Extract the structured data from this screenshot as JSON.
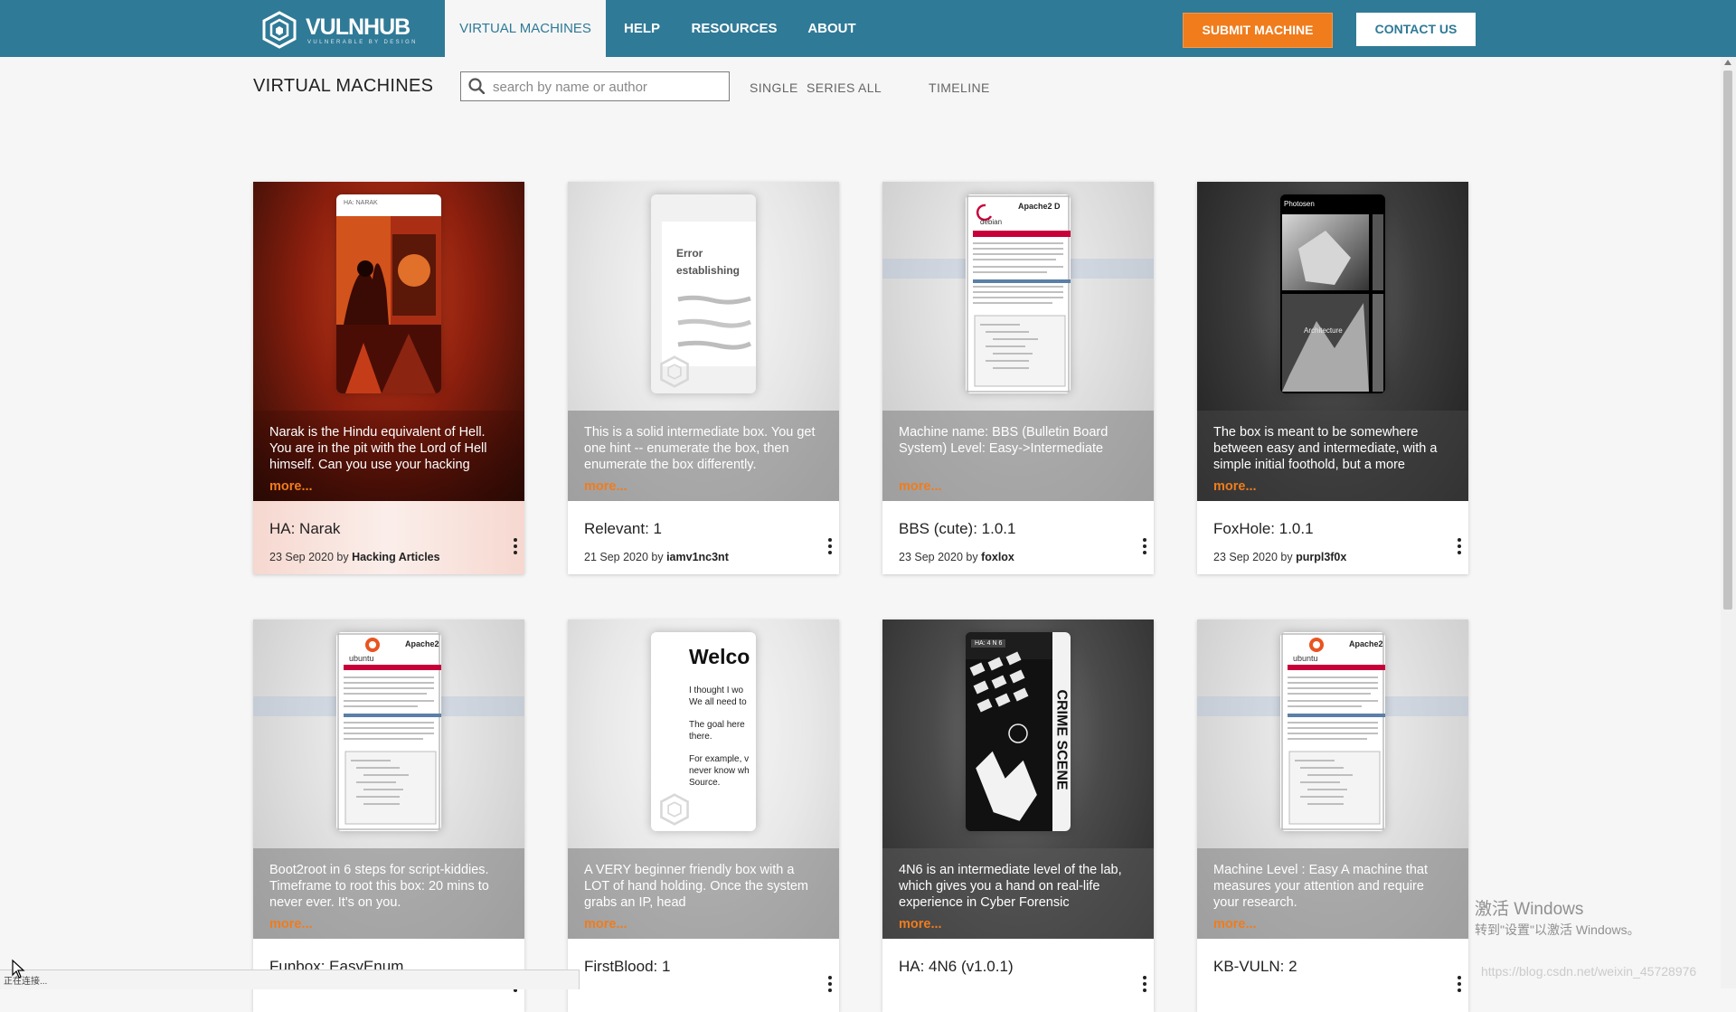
{
  "nav": {
    "brand": "VULNHUB",
    "tagline": "VULNERABLE BY DESIGN",
    "items": [
      {
        "label": "VIRTUAL MACHINES",
        "active": true
      },
      {
        "label": "HELP",
        "active": false
      },
      {
        "label": "RESOURCES",
        "active": false
      },
      {
        "label": "ABOUT",
        "active": false
      }
    ],
    "submit_label": "SUBMIT MACHINE",
    "contact_label": "CONTACT US"
  },
  "toolbar": {
    "title": "VIRTUAL MACHINES",
    "search_placeholder": "search by name or author",
    "search_value": "",
    "filters": [
      "SINGLE",
      "SERIES",
      "ALL",
      "TIMELINE"
    ]
  },
  "more_label": "more...",
  "machines": [
    {
      "title": "HA: Narak",
      "date": "23 Sep 2020",
      "by": "by",
      "author": "Hacking Articles",
      "description": "Narak is the Hindu equivalent of Hell. You are in the pit with the Lord of Hell himself. Can you use your hacking",
      "thumbnail": "ha-narak-artwork",
      "thumb_caption": "HA: NARAK"
    },
    {
      "title": "Relevant: 1",
      "date": "21 Sep 2020",
      "by": "by",
      "author": "iamv1nc3nt",
      "description": "This is a solid intermediate box. You get one hint -- enumerate the box, then enumerate the box differently.",
      "thumbnail": "error-page",
      "thumb_caption": "Error establishing your webz!"
    },
    {
      "title": "BBS (cute): 1.0.1",
      "date": "23 Sep 2020",
      "by": "by",
      "author": "foxlox",
      "description": "Machine name: BBS (Bulletin Board System) Level: Easy->Intermediate",
      "thumbnail": "debian-apache-default",
      "thumb_caption": "Apache2 D",
      "thumb_logo": "debian"
    },
    {
      "title": "FoxHole: 1.0.1",
      "date": "23 Sep 2020",
      "by": "by",
      "author": "purpl3f0x",
      "description": "The box is meant to be somewhere between easy and intermediate, with a simple initial foothold, but a more",
      "thumbnail": "photosen-gallery",
      "thumb_caption": "Photosen",
      "thumb_caption2": "Architecture"
    },
    {
      "title": "Funbox: EasyEnum",
      "date": "",
      "by": "",
      "author": "",
      "description": "Boot2root in 6 steps for script-kiddies. Timeframe to root this box: 20 mins to never ever. It's on you.",
      "thumbnail": "ubuntu-apache-default",
      "thumb_caption": "Apache2",
      "thumb_logo": "ubuntu"
    },
    {
      "title": "FirstBlood: 1",
      "date": "",
      "by": "",
      "author": "",
      "description": "A VERY beginner friendly box with a LOT of hand holding. Once the system grabs an IP, head",
      "thumbnail": "welcome-page",
      "thumb_caption": "Welco",
      "thumb_lines": [
        "I thought I wo",
        "We all need to",
        "The goal here",
        "there.",
        "For example, v",
        "never know wh",
        "Source."
      ]
    },
    {
      "title": "HA: 4N6 (v1.0.1)",
      "date": "",
      "by": "",
      "author": "",
      "description": "4N6 is an intermediate level of the lab, which gives you a hand on real-life experience in Cyber Forensic",
      "thumbnail": "crime-scene",
      "thumb_caption": "HA: 4 N 6",
      "thumb_caption2": "CRIME SCENE"
    },
    {
      "title": "KB-VULN: 2",
      "date": "",
      "by": "",
      "author": "",
      "description": "Machine Level : Easy A machine that measures your attention and require your research.",
      "thumbnail": "ubuntu-apache-default",
      "thumb_caption": "Apache2",
      "thumb_logo": "ubuntu"
    }
  ],
  "overlay": {
    "windows_watermark": "激活 Windows",
    "windows_watermark_sub": "转到\"设置\"以激活 Windows。",
    "csdn_watermark": "https://blog.csdn.net/weixin_45728976",
    "status_text": "正在连接..."
  },
  "colors": {
    "brand": "#2f7a97",
    "accent": "#f07c1c",
    "page_bg": "#f6f6f6"
  }
}
